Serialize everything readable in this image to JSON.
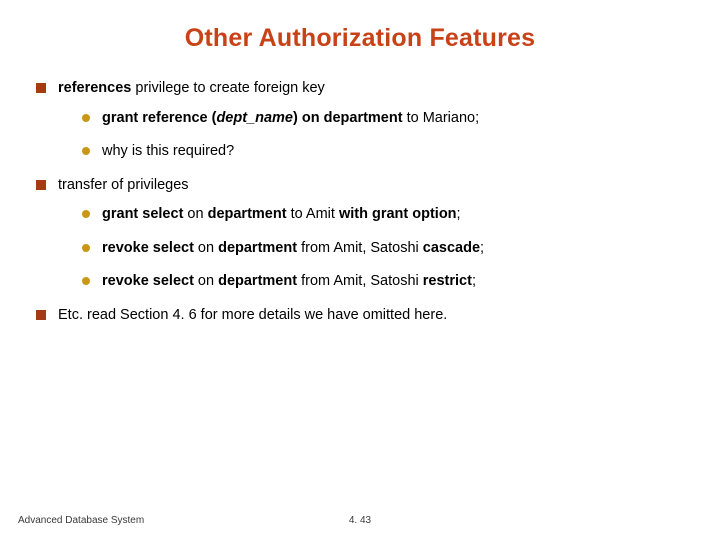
{
  "title": "Other Authorization Features",
  "items": {
    "i0": {
      "r0_bold": "references",
      "r0_rest": " privilege to create foreign key",
      "sub": {
        "s0": {
          "a": "grant reference (",
          "b": "dept_name",
          "c": ") on department",
          "d": " to Mariano;"
        },
        "s1": {
          "text": "why is this required?"
        }
      }
    },
    "i1": {
      "text": "transfer of privileges",
      "sub": {
        "s0": {
          "a": "grant select",
          "b": " on ",
          "c": "department",
          "d": " to Amit ",
          "e": "with grant option",
          "f": ";"
        },
        "s1": {
          "a": "revoke select",
          "b": " on ",
          "c": "department",
          "d": " from Amit, Satoshi ",
          "e": "cascade",
          "f": ";"
        },
        "s2": {
          "a": "revoke select",
          "b": " on ",
          "c": "department",
          "d": " from Amit, Satoshi ",
          "e": "restrict",
          "f": ";"
        }
      }
    },
    "i2": {
      "text": "Etc.  read Section 4. 6 for more details we have omitted here."
    }
  },
  "footer": {
    "left": "Advanced Database System",
    "center": "4. 43"
  }
}
